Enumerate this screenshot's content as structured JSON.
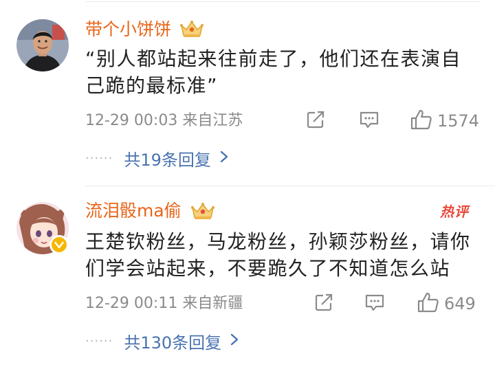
{
  "comments": [
    {
      "username": "带个小饼饼",
      "content": "“别人都站起来往前走了，他们还在表演自己跪的最标准”",
      "meta": "12-29 00:03  来自江苏",
      "likes": "1574",
      "replies": "共19条回复"
    },
    {
      "username": "流泪骰ma偷",
      "hot_label": "热评",
      "content": "王楚钦粉丝，马龙粉丝，孙颖莎粉丝，请你们学会站起来，不要跪久了不知道怎么站",
      "meta": "12-29 00:11  来自新疆",
      "likes": "649",
      "replies": "共130条回复"
    }
  ],
  "reply_prefix": "······",
  "colors": {
    "username": "#e8651a",
    "reply_link": "#4a73b0",
    "hot_badge": "#e84b3c",
    "meta": "#8a8a8a"
  },
  "icons": [
    "crown-icon",
    "share-icon",
    "comment-icon",
    "like-icon",
    "chevron-right-icon",
    "verified-icon"
  ]
}
